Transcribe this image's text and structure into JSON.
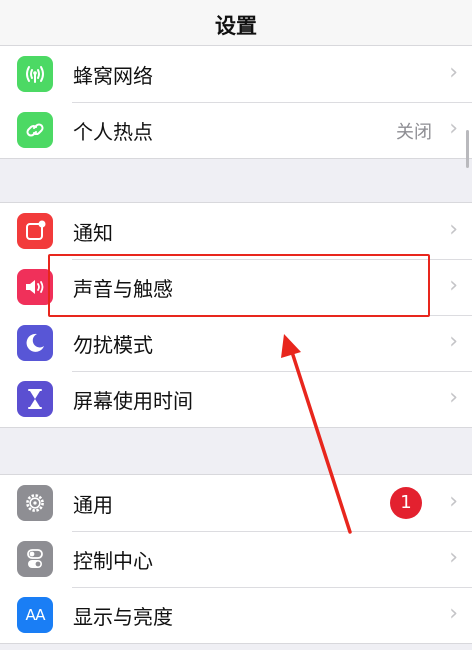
{
  "nav": {
    "title": "设置"
  },
  "groups": [
    {
      "rows": [
        {
          "label": "蜂窝网络",
          "icon": "cellular-icon",
          "color": "#4cd964"
        },
        {
          "label": "个人热点",
          "value": "关闭",
          "icon": "hotspot-icon",
          "color": "#4cd964"
        }
      ]
    },
    {
      "rows": [
        {
          "label": "通知",
          "icon": "notifications-icon",
          "color": "#f23b3b"
        },
        {
          "label": "声音与触感",
          "icon": "speaker-icon",
          "color": "#f0305a"
        },
        {
          "label": "勿扰模式",
          "icon": "moon-icon",
          "color": "#5856d6"
        },
        {
          "label": "屏幕使用时间",
          "icon": "hourglass-icon",
          "color": "#5b4fd1"
        }
      ]
    },
    {
      "rows": [
        {
          "label": "通用",
          "badge": "1",
          "icon": "gear-icon",
          "color": "#8e8e93"
        },
        {
          "label": "控制中心",
          "icon": "toggles-icon",
          "color": "#8e8e93"
        },
        {
          "label": "显示与亮度",
          "icon": "display-icon",
          "color": "#1a7ef5"
        }
      ]
    }
  ],
  "icon_glyphs": {
    "display-icon": "AA"
  },
  "annotation": {
    "highlight_color": "#e8261d"
  }
}
